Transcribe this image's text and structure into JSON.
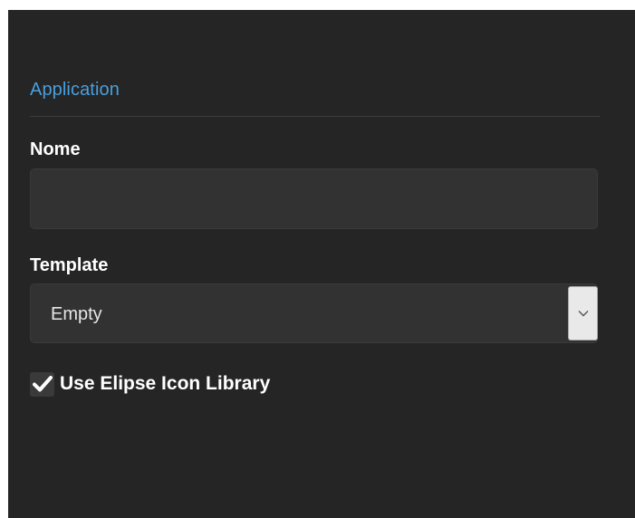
{
  "form": {
    "section_title": "Application",
    "name_label": "Nome",
    "name_value": "",
    "template_label": "Template",
    "template_selected": "Empty",
    "icon_library_label": "Use Elipse Icon Library",
    "icon_library_checked": true
  },
  "colors": {
    "panel_background": "#252525",
    "accent_title": "#4a9fdd",
    "input_background": "#323232"
  },
  "icons": {
    "dropdown": "chevron-down-icon",
    "checkbox": "checkmark-icon"
  }
}
